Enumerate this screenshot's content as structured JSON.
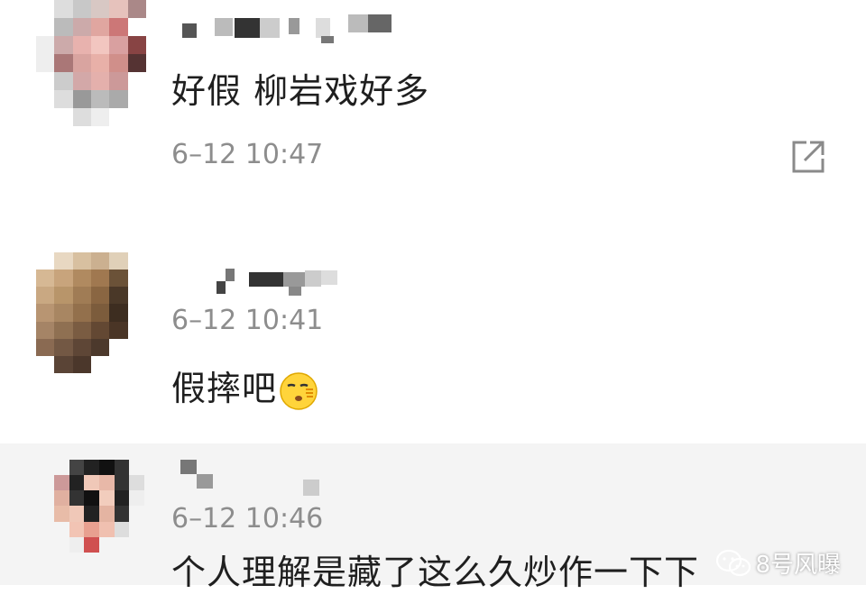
{
  "comments": [
    {
      "text": "好假 柳岩戏好多",
      "time": "6–12 10:47",
      "share_icon": "share-icon"
    },
    {
      "time": "6–12 10:41",
      "text": "假摔吧",
      "emoji": "smirk-emoji"
    },
    {
      "time": "6–12 10:46",
      "text": "个人理解是藏了这么久炒作一下下"
    }
  ],
  "watermark": {
    "icon": "wechat-icon",
    "text": "8号风曝"
  },
  "colors": {
    "text": "#1f1f1f",
    "time": "#8d8d8d",
    "highlight_bg": "#f4f4f4"
  }
}
